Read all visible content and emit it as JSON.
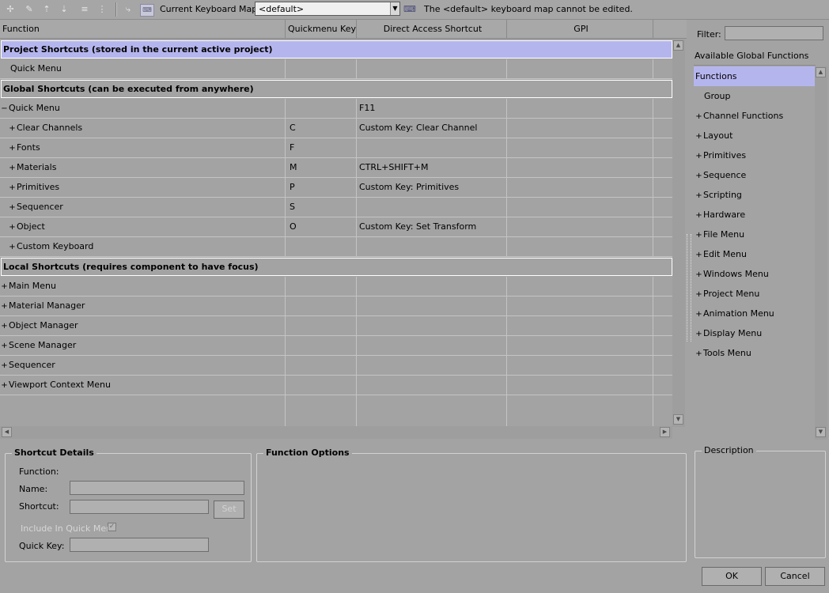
{
  "toolbar": {
    "keyboard_map_label": "Current Keyboard Map:",
    "keyboard_map_value": "<default>",
    "message": "The <default> keyboard map cannot be edited."
  },
  "table": {
    "headers": [
      "Function",
      "Quickmenu Key",
      "Direct Access Shortcut",
      "GPI"
    ],
    "project_section": "Project Shortcuts (stored in the current active project)",
    "project_rows": [
      {
        "fn": "Quick Menu",
        "key": "",
        "shortcut": ""
      }
    ],
    "global_section": "Global Shortcuts (can be executed from anywhere)",
    "global_rows": [
      {
        "exp": "−",
        "fn": "Quick Menu",
        "key": "",
        "shortcut": "F11",
        "indent": 0
      },
      {
        "exp": "+",
        "fn": "Clear Channels",
        "key": "C",
        "shortcut": "Custom Key: Clear Channel",
        "indent": 1
      },
      {
        "exp": "+",
        "fn": "Fonts",
        "key": "F",
        "shortcut": "",
        "indent": 1
      },
      {
        "exp": "+",
        "fn": "Materials",
        "key": "M",
        "shortcut": "CTRL+SHIFT+M",
        "indent": 1
      },
      {
        "exp": "+",
        "fn": "Primitives",
        "key": "P",
        "shortcut": "Custom Key: Primitives",
        "indent": 1
      },
      {
        "exp": "+",
        "fn": "Sequencer",
        "key": "S",
        "shortcut": "",
        "indent": 1
      },
      {
        "exp": "+",
        "fn": "Object",
        "key": "O",
        "shortcut": "Custom Key: Set Transform",
        "indent": 1
      },
      {
        "exp": "+",
        "fn": "Custom Keyboard",
        "key": "",
        "shortcut": "",
        "indent": 1
      }
    ],
    "local_section": "Local Shortcuts (requires component to have focus)",
    "local_rows": [
      {
        "exp": "+",
        "fn": "Main Menu"
      },
      {
        "exp": "+",
        "fn": "Material Manager"
      },
      {
        "exp": "+",
        "fn": "Object Manager"
      },
      {
        "exp": "+",
        "fn": "Scene Manager"
      },
      {
        "exp": "+",
        "fn": "Sequencer"
      },
      {
        "exp": "+",
        "fn": "Viewport Context Menu"
      }
    ]
  },
  "right_panel": {
    "filter_label": "Filter:",
    "filter_value": "",
    "header": "Available Global Functions",
    "items": [
      {
        "exp": "",
        "label": "Functions",
        "selected": true,
        "indent": 0
      },
      {
        "exp": "",
        "label": "Group",
        "indent": 1
      },
      {
        "exp": "+",
        "label": "Channel Functions",
        "indent": 0
      },
      {
        "exp": "+",
        "label": "Layout",
        "indent": 0
      },
      {
        "exp": "+",
        "label": "Primitives",
        "indent": 0
      },
      {
        "exp": "+",
        "label": "Sequence",
        "indent": 0
      },
      {
        "exp": "+",
        "label": "Scripting",
        "indent": 0
      },
      {
        "exp": "+",
        "label": "Hardware",
        "indent": 0
      },
      {
        "exp": "+",
        "label": "File Menu",
        "indent": 0
      },
      {
        "exp": "+",
        "label": "Edit Menu",
        "indent": 0
      },
      {
        "exp": "+",
        "label": "Windows Menu",
        "indent": 0
      },
      {
        "exp": "+",
        "label": "Project Menu",
        "indent": 0
      },
      {
        "exp": "+",
        "label": "Animation Menu",
        "indent": 0
      },
      {
        "exp": "+",
        "label": "Display Menu",
        "indent": 0
      },
      {
        "exp": "+",
        "label": "Tools Menu",
        "indent": 0
      }
    ],
    "description_title": "Description"
  },
  "shortcut_details": {
    "title": "Shortcut Details",
    "function_label": "Function:",
    "name_label": "Name:",
    "shortcut_label": "Shortcut:",
    "set_button": "Set",
    "include_label": "Include In Quick Menu",
    "include_checked": true,
    "quick_key_label": "Quick Key:"
  },
  "function_options": {
    "title": "Function Options"
  },
  "buttons": {
    "ok": "OK",
    "cancel": "Cancel"
  }
}
